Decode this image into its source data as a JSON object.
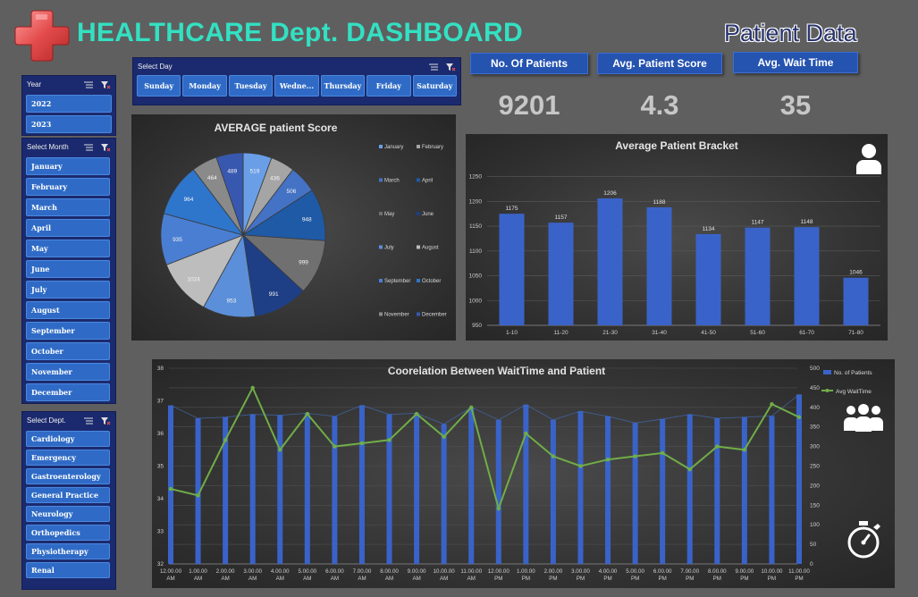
{
  "header": {
    "title": "HEALTHCARE Dept. DASHBOARD",
    "subtitle": "Patient Data",
    "logo_icon": "medical-cross-icon"
  },
  "slicers": {
    "day": {
      "label": "Select Day",
      "items": [
        "Sunday",
        "Monday",
        "Tuesday",
        "Wedne...",
        "Thursday",
        "Friday",
        "Saturday"
      ]
    },
    "year": {
      "label": "Year",
      "items": [
        "2022",
        "2023"
      ]
    },
    "month": {
      "label": "Select Month",
      "items": [
        "January",
        "February",
        "March",
        "April",
        "May",
        "June",
        "July",
        "August",
        "September",
        "October",
        "November",
        "December"
      ]
    },
    "dept": {
      "label": "Select Dept.",
      "items": [
        "Cardiology",
        "Emergency",
        "Gastroenterology",
        "General Practice",
        "Neurology",
        "Orthopedics",
        "Physiotherapy",
        "Renal"
      ]
    }
  },
  "kpis": [
    {
      "label": "No. Of Patients",
      "value": "9201"
    },
    {
      "label": "Avg. Patient Score",
      "value": "4.3"
    },
    {
      "label": "Avg. Wait Time",
      "value": "35"
    }
  ],
  "icons": [
    "person-icon",
    "group-icon",
    "stopwatch-icon"
  ],
  "colors": {
    "title": "#33e0c2",
    "bar": "#3a63c9",
    "line": "#70ad47",
    "slicer_button": "#2f6bc6",
    "slicer_panel": "#1b2a6e"
  },
  "chart_data": [
    {
      "type": "pie",
      "title": "AVERAGE patient Score",
      "categories": [
        "January",
        "February",
        "March",
        "April",
        "May",
        "June",
        "July",
        "August",
        "September",
        "October",
        "November",
        "December"
      ],
      "values": [
        519,
        436,
        506,
        948,
        999,
        991,
        953,
        1024,
        935,
        964,
        464,
        489
      ],
      "colors": [
        "#6a9fe8",
        "#a5a5a5",
        "#4472c4",
        "#1f5aa6",
        "#707070",
        "#1e3f86",
        "#5b8fd9",
        "#bdbdbd",
        "#4a7ed2",
        "#2e75cc",
        "#8a8a8a",
        "#3858b0"
      ],
      "legend_position": "right"
    },
    {
      "type": "bar",
      "title": "Average Patient Bracket",
      "categories": [
        "1-10",
        "11-20",
        "21-30",
        "31-40",
        "41-50",
        "51-60",
        "61-70",
        "71-80"
      ],
      "values": [
        1175,
        1157,
        1206,
        1188,
        1134,
        1147,
        1148,
        1046
      ],
      "yticks": [
        950,
        1000,
        1050,
        1100,
        1150,
        1200,
        1250
      ],
      "ylim": [
        950,
        1260
      ],
      "grid": true
    },
    {
      "type": "bar",
      "title": "Coorelation Between WaitTime and Patient",
      "categories": [
        "12.00.00 AM",
        "1.00.00 AM",
        "2.00.00 AM",
        "3.00.00 AM",
        "4.00.00 AM",
        "5.00.00 AM",
        "6.00.00 AM",
        "7.00.00 AM",
        "8.00.00 AM",
        "9.00.00 AM",
        "10.00.00 AM",
        "11.00.00 AM",
        "12.00.00 PM",
        "1.00.00 PM",
        "2.00.00 PM",
        "3.00.00 PM",
        "4.00.00 PM",
        "5.00.00 PM",
        "6.00.00 PM",
        "7.00.00 PM",
        "8.00.00 PM",
        "9.00.00 PM",
        "10.00.00 PM",
        "11.00.00 PM"
      ],
      "series": [
        {
          "name": "No. of Patients",
          "type": "bar",
          "axis": "right",
          "values": [
            405,
            372,
            375,
            382,
            380,
            385,
            377,
            405,
            382,
            385,
            357,
            400,
            368,
            407,
            368,
            390,
            377,
            360,
            370,
            382,
            372,
            375,
            378,
            433
          ]
        },
        {
          "name": "Avg WaitTime",
          "type": "line",
          "axis": "left",
          "values": [
            34.3,
            34.1,
            35.8,
            37.4,
            35.5,
            36.6,
            35.6,
            35.7,
            35.8,
            36.6,
            35.9,
            36.8,
            33.7,
            36.0,
            35.3,
            35.0,
            35.2,
            35.3,
            35.4,
            34.9,
            35.6,
            35.5,
            36.9,
            36.5
          ]
        }
      ],
      "ylim_left": [
        32,
        38
      ],
      "ylim_right": [
        0,
        500
      ],
      "yticks_left": [
        32,
        33,
        34,
        35,
        36,
        37,
        38
      ],
      "yticks_right": [
        0,
        50,
        100,
        150,
        200,
        250,
        300,
        350,
        400,
        450,
        500
      ],
      "legend_position": "top-right"
    }
  ]
}
